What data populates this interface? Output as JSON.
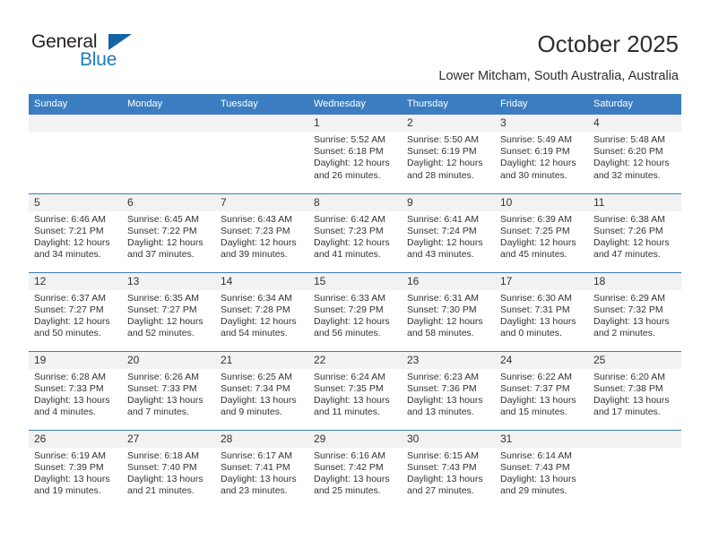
{
  "brand": {
    "name_top": "General",
    "name_bottom": "Blue",
    "accent_color": "#1464a5",
    "blue_text_color": "#1f7bc1"
  },
  "header": {
    "title": "October 2025",
    "subtitle": "Lower Mitcham, South Australia, Australia",
    "header_bg": "#3b7dc0"
  },
  "weekdays": [
    "Sunday",
    "Monday",
    "Tuesday",
    "Wednesday",
    "Thursday",
    "Friday",
    "Saturday"
  ],
  "weeks": [
    [
      {
        "day": "",
        "lines": []
      },
      {
        "day": "",
        "lines": []
      },
      {
        "day": "",
        "lines": []
      },
      {
        "day": "1",
        "lines": [
          "Sunrise: 5:52 AM",
          "Sunset: 6:18 PM",
          "Daylight: 12 hours",
          "and 26 minutes."
        ]
      },
      {
        "day": "2",
        "lines": [
          "Sunrise: 5:50 AM",
          "Sunset: 6:19 PM",
          "Daylight: 12 hours",
          "and 28 minutes."
        ]
      },
      {
        "day": "3",
        "lines": [
          "Sunrise: 5:49 AM",
          "Sunset: 6:19 PM",
          "Daylight: 12 hours",
          "and 30 minutes."
        ]
      },
      {
        "day": "4",
        "lines": [
          "Sunrise: 5:48 AM",
          "Sunset: 6:20 PM",
          "Daylight: 12 hours",
          "and 32 minutes."
        ]
      }
    ],
    [
      {
        "day": "5",
        "lines": [
          "Sunrise: 6:46 AM",
          "Sunset: 7:21 PM",
          "Daylight: 12 hours",
          "and 34 minutes."
        ]
      },
      {
        "day": "6",
        "lines": [
          "Sunrise: 6:45 AM",
          "Sunset: 7:22 PM",
          "Daylight: 12 hours",
          "and 37 minutes."
        ]
      },
      {
        "day": "7",
        "lines": [
          "Sunrise: 6:43 AM",
          "Sunset: 7:23 PM",
          "Daylight: 12 hours",
          "and 39 minutes."
        ]
      },
      {
        "day": "8",
        "lines": [
          "Sunrise: 6:42 AM",
          "Sunset: 7:23 PM",
          "Daylight: 12 hours",
          "and 41 minutes."
        ]
      },
      {
        "day": "9",
        "lines": [
          "Sunrise: 6:41 AM",
          "Sunset: 7:24 PM",
          "Daylight: 12 hours",
          "and 43 minutes."
        ]
      },
      {
        "day": "10",
        "lines": [
          "Sunrise: 6:39 AM",
          "Sunset: 7:25 PM",
          "Daylight: 12 hours",
          "and 45 minutes."
        ]
      },
      {
        "day": "11",
        "lines": [
          "Sunrise: 6:38 AM",
          "Sunset: 7:26 PM",
          "Daylight: 12 hours",
          "and 47 minutes."
        ]
      }
    ],
    [
      {
        "day": "12",
        "lines": [
          "Sunrise: 6:37 AM",
          "Sunset: 7:27 PM",
          "Daylight: 12 hours",
          "and 50 minutes."
        ]
      },
      {
        "day": "13",
        "lines": [
          "Sunrise: 6:35 AM",
          "Sunset: 7:27 PM",
          "Daylight: 12 hours",
          "and 52 minutes."
        ]
      },
      {
        "day": "14",
        "lines": [
          "Sunrise: 6:34 AM",
          "Sunset: 7:28 PM",
          "Daylight: 12 hours",
          "and 54 minutes."
        ]
      },
      {
        "day": "15",
        "lines": [
          "Sunrise: 6:33 AM",
          "Sunset: 7:29 PM",
          "Daylight: 12 hours",
          "and 56 minutes."
        ]
      },
      {
        "day": "16",
        "lines": [
          "Sunrise: 6:31 AM",
          "Sunset: 7:30 PM",
          "Daylight: 12 hours",
          "and 58 minutes."
        ]
      },
      {
        "day": "17",
        "lines": [
          "Sunrise: 6:30 AM",
          "Sunset: 7:31 PM",
          "Daylight: 13 hours",
          "and 0 minutes."
        ]
      },
      {
        "day": "18",
        "lines": [
          "Sunrise: 6:29 AM",
          "Sunset: 7:32 PM",
          "Daylight: 13 hours",
          "and 2 minutes."
        ]
      }
    ],
    [
      {
        "day": "19",
        "lines": [
          "Sunrise: 6:28 AM",
          "Sunset: 7:33 PM",
          "Daylight: 13 hours",
          "and 4 minutes."
        ]
      },
      {
        "day": "20",
        "lines": [
          "Sunrise: 6:26 AM",
          "Sunset: 7:33 PM",
          "Daylight: 13 hours",
          "and 7 minutes."
        ]
      },
      {
        "day": "21",
        "lines": [
          "Sunrise: 6:25 AM",
          "Sunset: 7:34 PM",
          "Daylight: 13 hours",
          "and 9 minutes."
        ]
      },
      {
        "day": "22",
        "lines": [
          "Sunrise: 6:24 AM",
          "Sunset: 7:35 PM",
          "Daylight: 13 hours",
          "and 11 minutes."
        ]
      },
      {
        "day": "23",
        "lines": [
          "Sunrise: 6:23 AM",
          "Sunset: 7:36 PM",
          "Daylight: 13 hours",
          "and 13 minutes."
        ]
      },
      {
        "day": "24",
        "lines": [
          "Sunrise: 6:22 AM",
          "Sunset: 7:37 PM",
          "Daylight: 13 hours",
          "and 15 minutes."
        ]
      },
      {
        "day": "25",
        "lines": [
          "Sunrise: 6:20 AM",
          "Sunset: 7:38 PM",
          "Daylight: 13 hours",
          "and 17 minutes."
        ]
      }
    ],
    [
      {
        "day": "26",
        "lines": [
          "Sunrise: 6:19 AM",
          "Sunset: 7:39 PM",
          "Daylight: 13 hours",
          "and 19 minutes."
        ]
      },
      {
        "day": "27",
        "lines": [
          "Sunrise: 6:18 AM",
          "Sunset: 7:40 PM",
          "Daylight: 13 hours",
          "and 21 minutes."
        ]
      },
      {
        "day": "28",
        "lines": [
          "Sunrise: 6:17 AM",
          "Sunset: 7:41 PM",
          "Daylight: 13 hours",
          "and 23 minutes."
        ]
      },
      {
        "day": "29",
        "lines": [
          "Sunrise: 6:16 AM",
          "Sunset: 7:42 PM",
          "Daylight: 13 hours",
          "and 25 minutes."
        ]
      },
      {
        "day": "30",
        "lines": [
          "Sunrise: 6:15 AM",
          "Sunset: 7:43 PM",
          "Daylight: 13 hours",
          "and 27 minutes."
        ]
      },
      {
        "day": "31",
        "lines": [
          "Sunrise: 6:14 AM",
          "Sunset: 7:43 PM",
          "Daylight: 13 hours",
          "and 29 minutes."
        ]
      },
      {
        "day": "",
        "lines": []
      }
    ]
  ]
}
